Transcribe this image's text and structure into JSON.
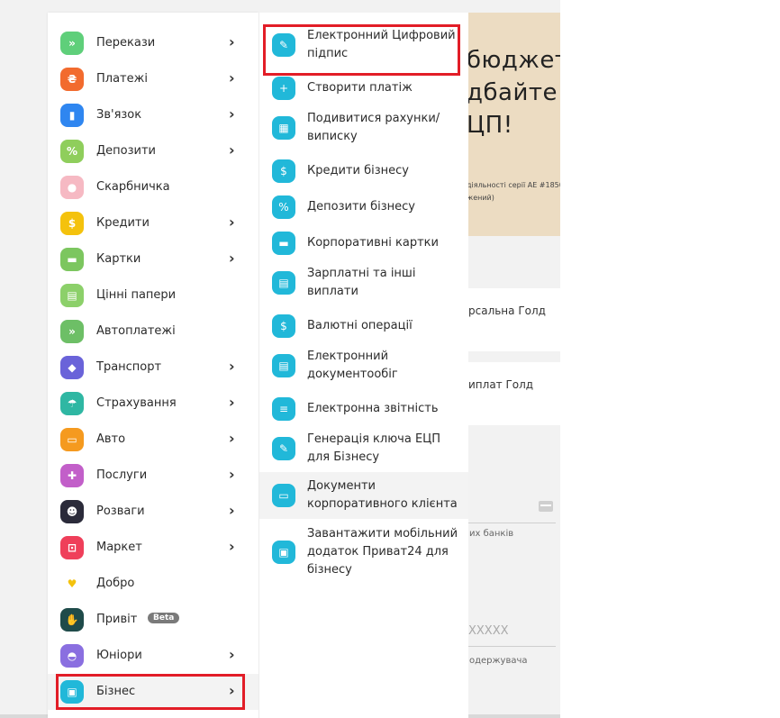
{
  "background": {
    "banner_lines": [
      "бюджет",
      "дбайте",
      "ЦП!"
    ],
    "banner_small_1": "діяльності серії АЕ #18509",
    "banner_small_2": "жений)",
    "card1_text": "рсальна Голд",
    "card2_text": "иплат Голд",
    "card3_hint": "их банків",
    "input_placeholder": "XXXXX",
    "recipient_hint": "одержувача"
  },
  "left_menu": [
    {
      "label": "Перекази",
      "icon": "double-chevron-icon",
      "color": "#5fcf7a",
      "glyph": "»",
      "chevron": true
    },
    {
      "label": "Платежі",
      "icon": "payment-icon",
      "color": "#f26b2e",
      "glyph": "₴",
      "chevron": true
    },
    {
      "label": "Зв'язок",
      "icon": "signal-icon",
      "color": "#2f86f0",
      "glyph": "▮",
      "chevron": true
    },
    {
      "label": "Депозити",
      "icon": "percent-icon",
      "color": "#8fce5c",
      "glyph": "%",
      "chevron": true
    },
    {
      "label": "Скарбничка",
      "icon": "piggy-bank-icon",
      "color": "#f6b9c3",
      "glyph": "●",
      "chevron": false
    },
    {
      "label": "Кредити",
      "icon": "money-bag-icon",
      "color": "#f4c20d",
      "glyph": "$",
      "chevron": true
    },
    {
      "label": "Картки",
      "icon": "card-icon",
      "color": "#7cc65f",
      "glyph": "▬",
      "chevron": true
    },
    {
      "label": "Цінні папери",
      "icon": "document-icon",
      "color": "#8cd06a",
      "glyph": "▤",
      "chevron": false
    },
    {
      "label": "Автоплатежі",
      "icon": "autopay-icon",
      "color": "#6dbf66",
      "glyph": "»",
      "chevron": false
    },
    {
      "label": "Транспорт",
      "icon": "ticket-icon",
      "color": "#6a63d9",
      "glyph": "◆",
      "chevron": true
    },
    {
      "label": "Страхування",
      "icon": "umbrella-icon",
      "color": "#2fb7a3",
      "glyph": "☂",
      "chevron": true
    },
    {
      "label": "Авто",
      "icon": "car-icon",
      "color": "#f59a1f",
      "glyph": "▭",
      "chevron": true
    },
    {
      "label": "Послуги",
      "icon": "puzzle-icon",
      "color": "#c25fc9",
      "glyph": "✚",
      "chevron": true
    },
    {
      "label": "Розваги",
      "icon": "entertainment-icon",
      "color": "#2b2b3a",
      "glyph": "☻",
      "chevron": true
    },
    {
      "label": "Маркет",
      "icon": "cart-icon",
      "color": "#ef3f5a",
      "glyph": "⊡",
      "chevron": true
    },
    {
      "label": "Добро",
      "icon": "heart-icon",
      "color": "#ffffff",
      "glyph": "♥",
      "chevron": false
    },
    {
      "label": "Привіт",
      "icon": "wave-hand-icon",
      "color": "#1f4b4a",
      "glyph": "✋",
      "chevron": false,
      "badge": "Beta"
    },
    {
      "label": "Юніори",
      "icon": "helmet-icon",
      "color": "#8a6fe0",
      "glyph": "◓",
      "chevron": true
    },
    {
      "label": "Бізнес",
      "icon": "briefcase-icon",
      "color": "#21b8d9",
      "glyph": "▣",
      "chevron": true,
      "active": true
    }
  ],
  "sub_menu": [
    {
      "label": "Електронний Цифровий підпис",
      "icon": "signature-pen-icon",
      "glyph": "✎",
      "lines": 2
    },
    {
      "label": "Створити платіж",
      "icon": "plus-icon",
      "glyph": "+",
      "lines": 1
    },
    {
      "label": "Подивитися рахунки/ виписку",
      "icon": "accounts-icon",
      "glyph": "▦",
      "lines": 2
    },
    {
      "label": "Кредити бізнесу",
      "icon": "business-credit-icon",
      "glyph": "$",
      "lines": 1
    },
    {
      "label": "Депозити бізнесу",
      "icon": "business-deposit-icon",
      "glyph": "%",
      "lines": 1
    },
    {
      "label": "Корпоративні картки",
      "icon": "corporate-card-icon",
      "glyph": "▬",
      "lines": 1
    },
    {
      "label": "Зарплатні та інші виплати",
      "icon": "salary-icon",
      "glyph": "▤",
      "lines": 2
    },
    {
      "label": "Валютні операції",
      "icon": "currency-icon",
      "glyph": "$",
      "lines": 1
    },
    {
      "label": "Електронний документообіг",
      "icon": "document-flow-icon",
      "glyph": "▤",
      "lines": 2
    },
    {
      "label": "Електронна звітність",
      "icon": "report-icon",
      "glyph": "≡",
      "lines": 1
    },
    {
      "label": "Генерація ключа ЕЦП для Бізнесу",
      "icon": "key-generation-icon",
      "glyph": "✎",
      "lines": 2
    },
    {
      "label": "Документи корпоративного клієнта",
      "icon": "id-card-icon",
      "glyph": "▭",
      "lines": 2,
      "active": true
    },
    {
      "label": "Завантажити мобільний додаток Приват24 для бізнесу",
      "icon": "mobile-app-icon",
      "glyph": "▣",
      "lines": 3
    }
  ]
}
